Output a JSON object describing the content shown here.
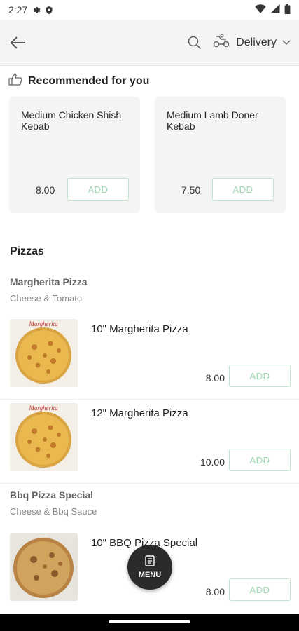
{
  "status_bar": {
    "time": "2:27",
    "icons": [
      "gear-icon",
      "shield-icon",
      "wifi-icon",
      "signal-icon",
      "battery-icon"
    ]
  },
  "app_bar": {
    "back_icon": "arrow-left-icon",
    "search_icon": "search-icon",
    "delivery_icon": "scooter-icon",
    "delivery_label": "Delivery",
    "dropdown_icon": "chevron-down-icon"
  },
  "recommended": {
    "title": "Recommended for you",
    "icon": "thumbs-up-icon",
    "items": [
      {
        "name": "Medium Chicken Shish Kebab",
        "price": "8.00",
        "add_label": "ADD"
      },
      {
        "name": "Medium Lamb Doner Kebab",
        "price": "7.50",
        "add_label": "ADD"
      }
    ]
  },
  "pizzas": {
    "title": "Pizzas",
    "groups": [
      {
        "title": "Margherita Pizza",
        "subtitle": "Cheese & Tomato",
        "items": [
          {
            "name": "10\" Margherita Pizza",
            "price": "8.00",
            "add_label": "ADD",
            "box_label": "Margherita"
          },
          {
            "name": "12\" Margherita Pizza",
            "price": "10.00",
            "add_label": "ADD",
            "box_label": "Margherita"
          }
        ]
      },
      {
        "title": "Bbq Pizza Special",
        "subtitle": "Cheese & Bbq Sauce",
        "items": [
          {
            "name": "10\" BBQ Pizza Special",
            "price": "8.00",
            "add_label": "ADD"
          }
        ]
      }
    ]
  },
  "menu_button": {
    "label": "MENU",
    "icon": "menu-book-icon"
  },
  "colors": {
    "accent_green": "#9fd7b3",
    "card_bg": "#f4f4f4",
    "fab_bg": "#2b2b2b"
  }
}
